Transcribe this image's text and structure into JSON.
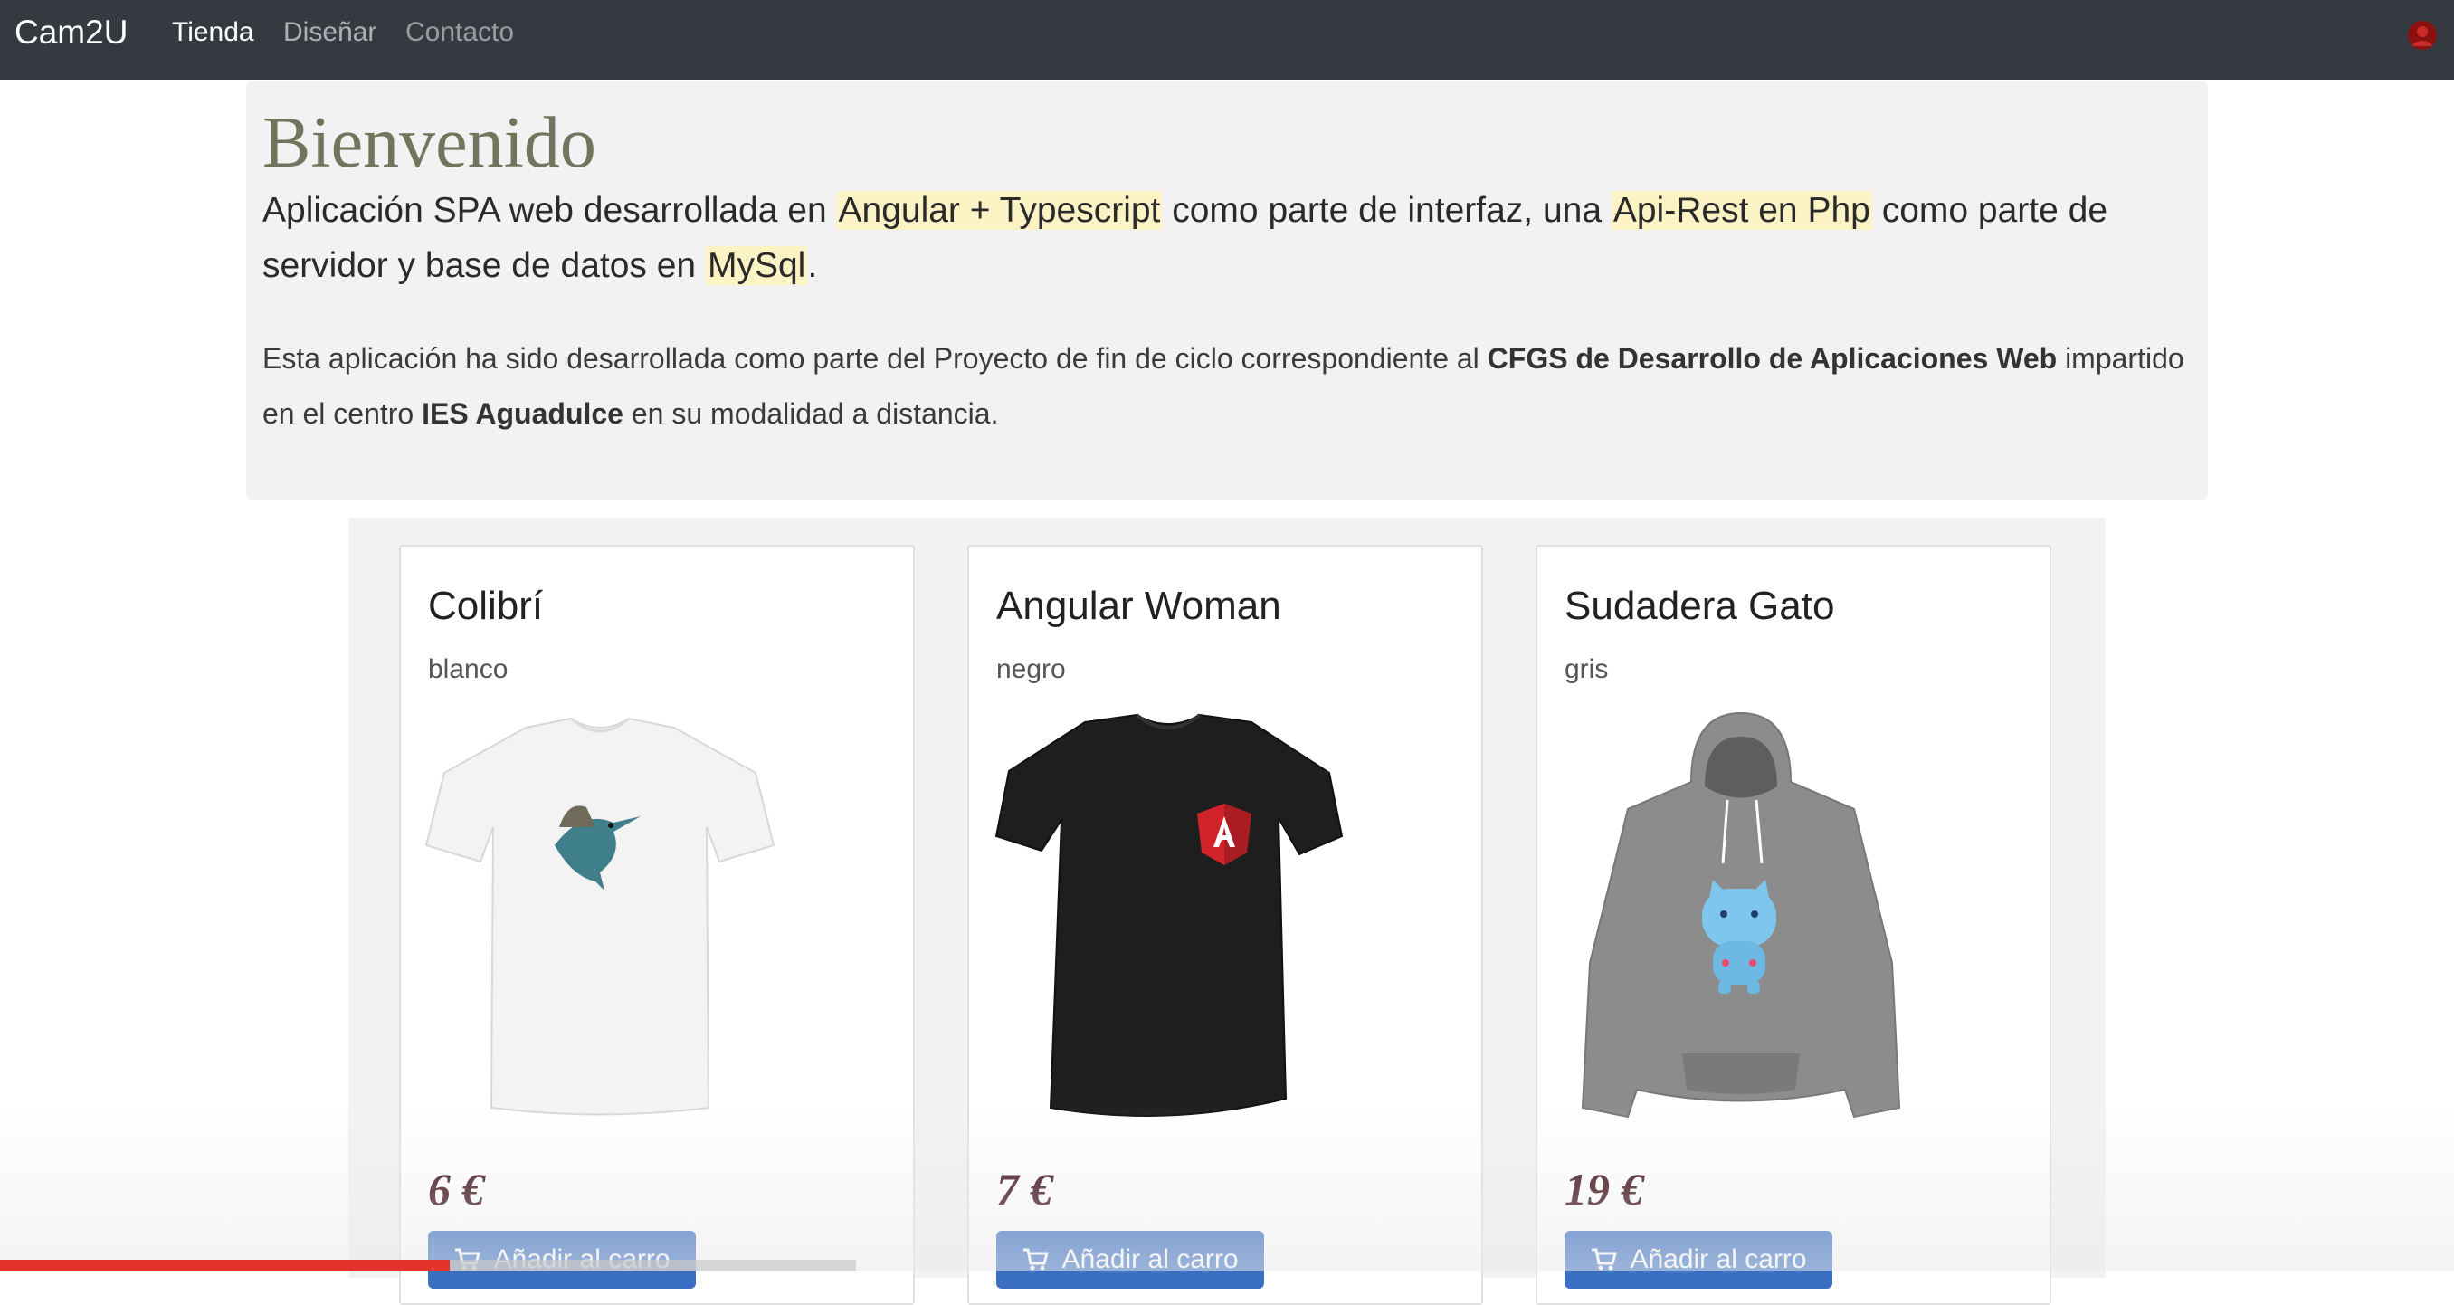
{
  "navbar": {
    "brand": "Cam2U",
    "links": [
      "Tienda",
      "Diseñar",
      "Contacto"
    ]
  },
  "jumbotron": {
    "title": "Bienvenido",
    "lead": {
      "p1": "Aplicación SPA web desarrollada en ",
      "h1": "Angular + Typescript",
      "p2": " como parte de interfaz, una ",
      "h2": "Api-Rest en Php",
      "p3": " como parte de servidor y base de datos en ",
      "h3": "MySql",
      "p4": "."
    },
    "description": {
      "p1": "Esta aplicación ha sido desarrollada como parte del Proyecto de fin de ciclo correspondiente al ",
      "b1": "CFGS de Desarrollo de Aplicaciones Web",
      "p2": " impartido en el centro ",
      "b2": "IES Aguadulce",
      "p3": " en su modalidad a distancia."
    }
  },
  "products": [
    {
      "name": "Colibrí",
      "color": "blanco",
      "price": "6 €",
      "button": "Añadir al carro",
      "image": "white-tshirt-hummingbird"
    },
    {
      "name": "Angular Woman",
      "color": "negro",
      "price": "7 €",
      "button": "Añadir al carro",
      "image": "black-tshirt-angular-logo"
    },
    {
      "name": "Sudadera Gato",
      "color": "gris",
      "price": "19 €",
      "button": "Añadir al carro",
      "image": "grey-hoodie-blue-cat"
    }
  ],
  "video_progress": 0.525,
  "colors": {
    "navbar": "#343a40",
    "highlight": "#fcf3c5",
    "button": "#3a6fc2",
    "price": "#3a0d15",
    "title": "#72755e",
    "progress": "#e5322d"
  }
}
